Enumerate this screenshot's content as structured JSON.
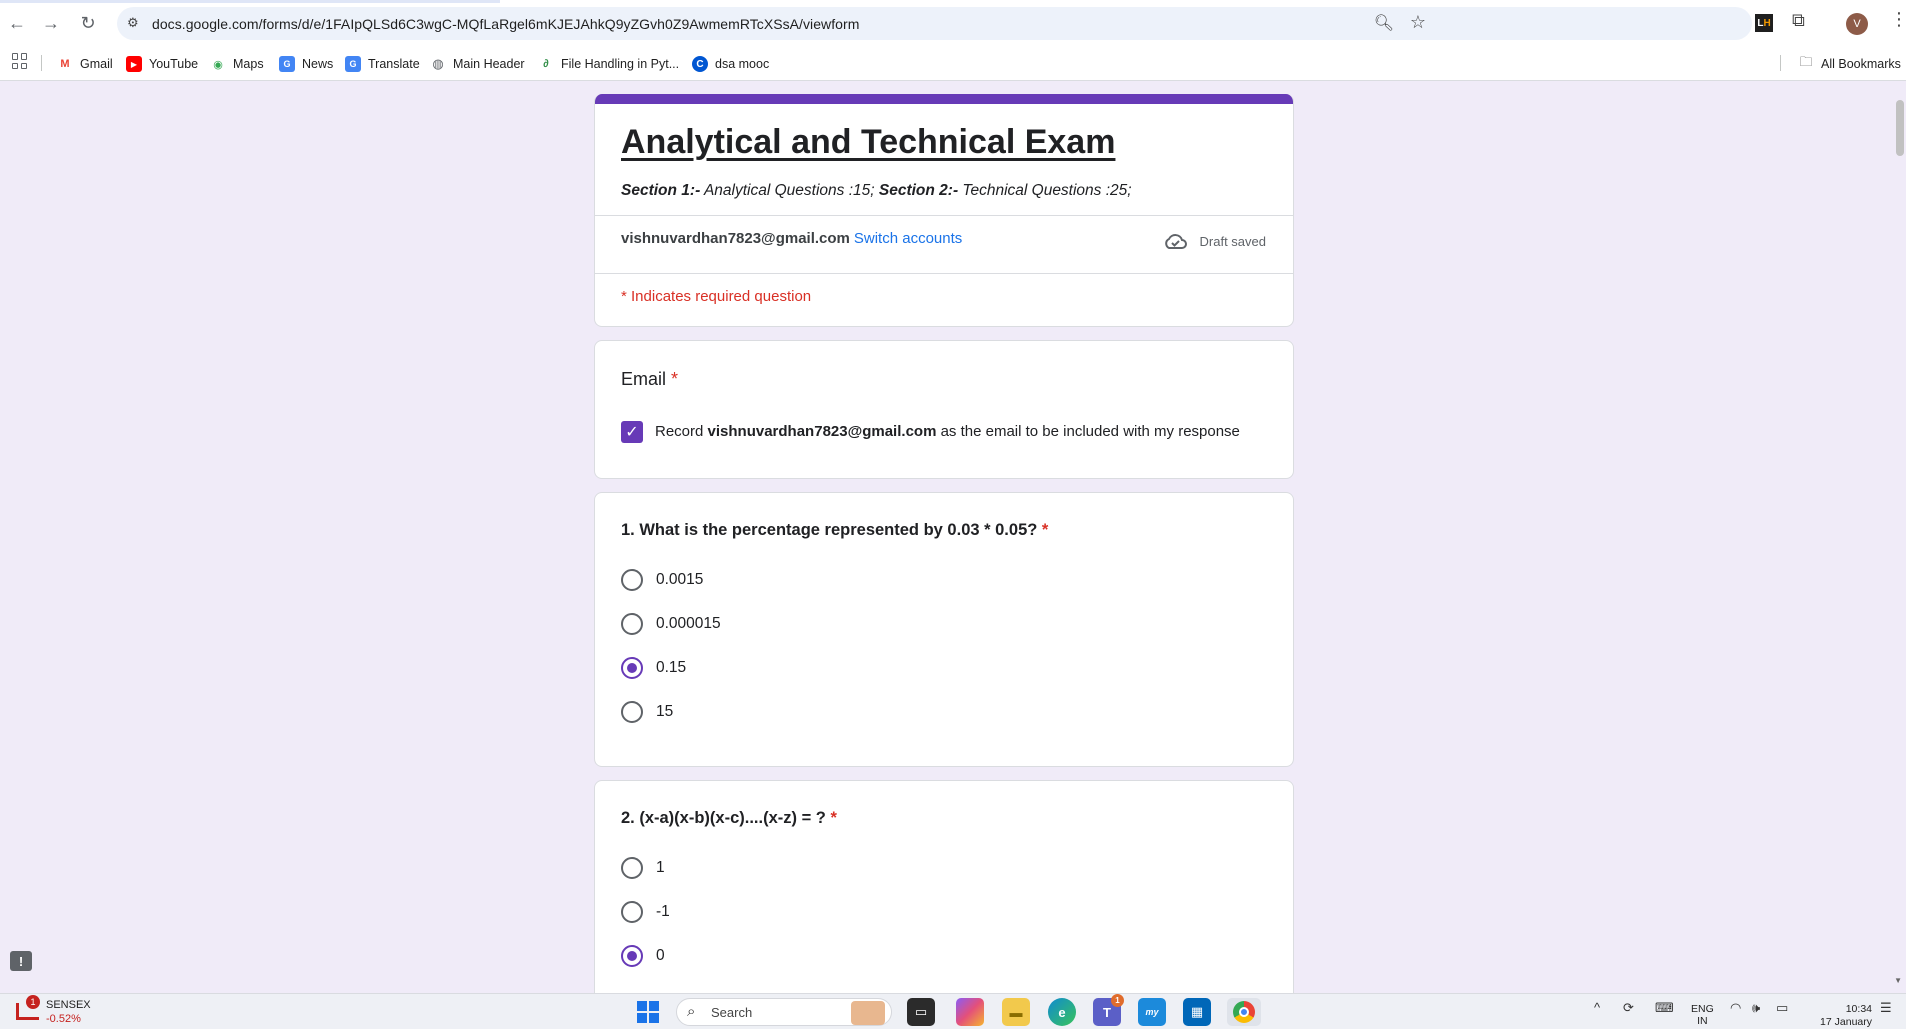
{
  "browser": {
    "url": "docs.google.com/forms/d/e/1FAIpQLSd6C3wgC-MQfLaRgel6mKJEJAhkQ9yZGvh0Z9AwmemRTcXSsA/viewform",
    "profile_initial": "V",
    "bookmarks": [
      {
        "label": "Gmail",
        "icon": "gmail-icon",
        "color": "#ea4335",
        "glyph": "M"
      },
      {
        "label": "YouTube",
        "icon": "youtube-icon",
        "color": "#ff0000",
        "glyph": "▶"
      },
      {
        "label": "Maps",
        "icon": "maps-icon",
        "color": "#34a853",
        "glyph": "◉"
      },
      {
        "label": "News",
        "icon": "news-icon",
        "color": "#4285f4",
        "glyph": "G"
      },
      {
        "label": "Translate",
        "icon": "translate-icon",
        "color": "#4285f4",
        "glyph": "G"
      },
      {
        "label": "Main Header",
        "icon": "globe-icon",
        "color": "#5f6368",
        "glyph": "◍"
      },
      {
        "label": "File Handling in Pyt...",
        "icon": "gfg-icon",
        "color": "#2f8d46",
        "glyph": "∂"
      },
      {
        "label": "dsa mooc",
        "icon": "coursera-icon",
        "color": "#0056d2",
        "glyph": "C"
      }
    ],
    "all_bookmarks": "All Bookmarks"
  },
  "form": {
    "title": "Analytical and Technical Exam",
    "desc_s1": "Section 1:-",
    "desc_s1_text": " Analytical Questions :15; ",
    "desc_s2": "Section 2:-",
    "desc_s2_text": " Technical Questions :25;",
    "account_email": "vishnuvardhan7823@gmail.com",
    "switch_accounts": "Switch accounts",
    "draft_status": "Draft saved",
    "required_note": "* Indicates required question",
    "accent_color": "#673ab7",
    "required_color": "#d93025"
  },
  "email_question": {
    "label": "Email",
    "star": "*",
    "record_prefix": "Record",
    "record_email": "vishnuvardhan7823@gmail.com",
    "record_suffix": "as the email to be included with my response",
    "checked": true
  },
  "questions": [
    {
      "title": "1. What is the percentage represented by 0.03 * 0.05?",
      "star": "*",
      "options": [
        "0.0015",
        "0.000015",
        "0.15",
        "15"
      ],
      "selected": "0.15"
    },
    {
      "title": "2. (x-a)(x-b)(x-c)....(x-z) = ?",
      "star": "*",
      "options": [
        "1",
        "-1",
        "0"
      ],
      "selected": "0"
    }
  ],
  "taskbar": {
    "ticker_name": "SENSEX",
    "ticker_change": "-0.52%",
    "ticker_badge": "1",
    "search_label": "Search",
    "teams_badge": "1",
    "lang_line1": "ENG",
    "lang_line2": "IN",
    "time": "10:34",
    "date": "17 January"
  }
}
